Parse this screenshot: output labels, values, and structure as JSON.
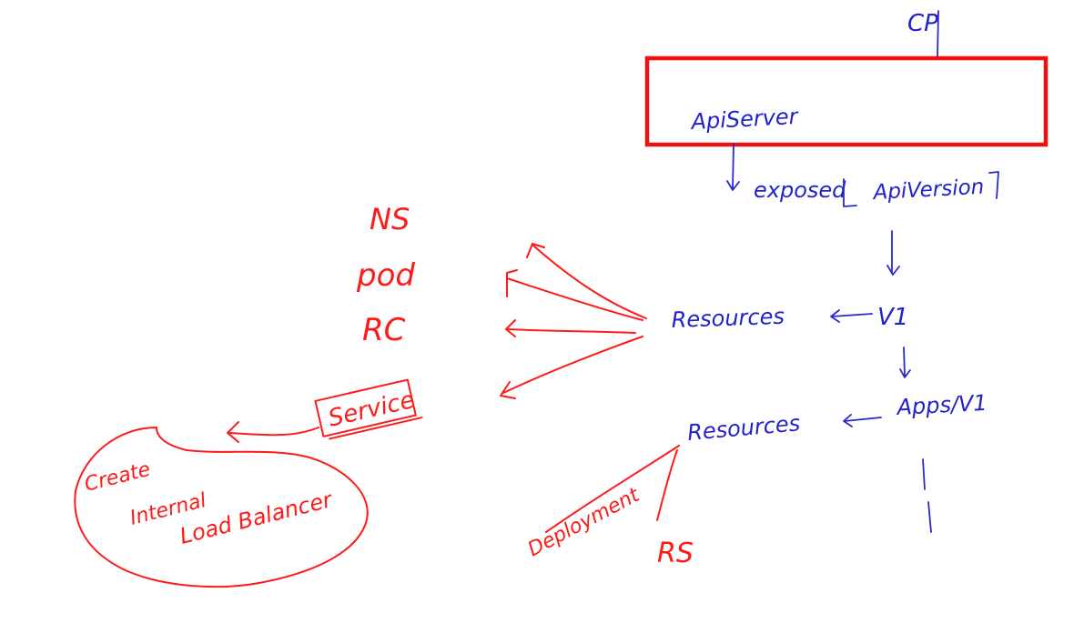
{
  "labels": {
    "cp": "CP",
    "api_server": "ApiServer",
    "exposed": "exposed",
    "api_version": "ApiVersion",
    "v1": "V1",
    "resources_1": "Resources",
    "apps_v1": "Apps/V1",
    "resources_2": "Resources",
    "ns": "NS",
    "pod": "pod",
    "rc": "RC",
    "service": "Service",
    "create": "Create",
    "internal": "Internal",
    "load_balancer": "Load Balancer",
    "deployment": "Deployment",
    "rs": "RS"
  },
  "colors": {
    "red_ink": "#ff1a1a",
    "blue_ink": "#2222cc"
  }
}
